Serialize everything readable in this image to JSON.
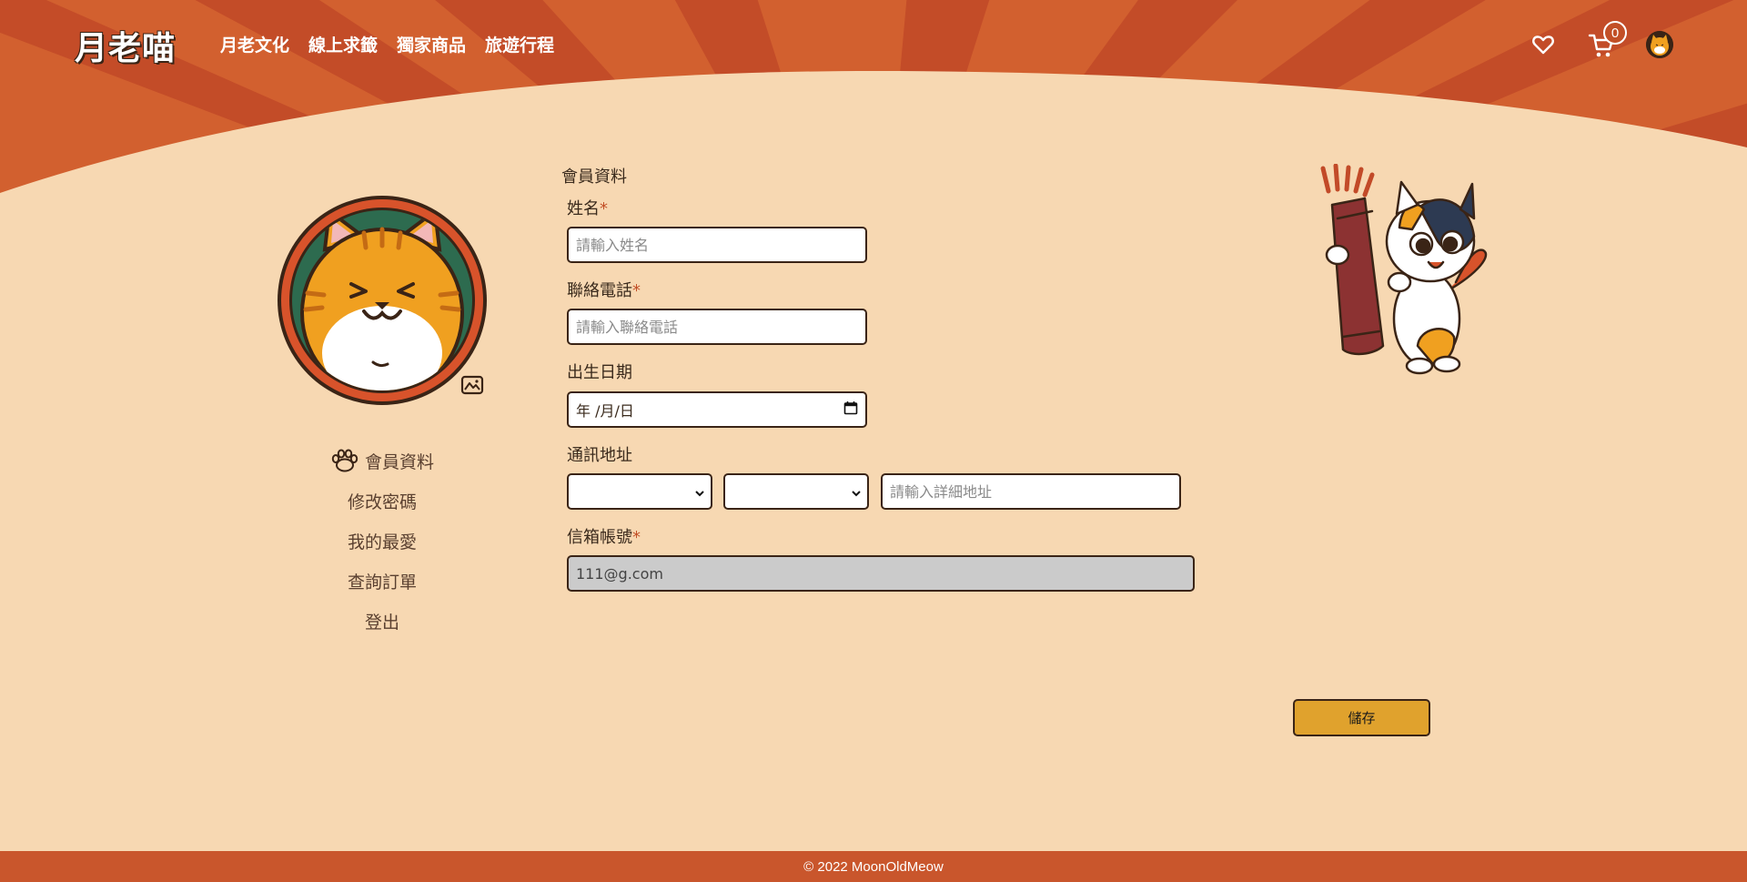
{
  "brand": {
    "logo_text": "月老喵"
  },
  "nav": {
    "items": [
      "月老文化",
      "線上求籤",
      "獨家商品",
      "旅遊行程"
    ]
  },
  "header": {
    "cart_count": "0"
  },
  "icons": {
    "wishlist": "heart-icon",
    "cart": "cart-icon",
    "user": "user-avatar-icon",
    "upload": "image-upload-icon",
    "menu_active": "paw-icon"
  },
  "sidebar": {
    "items": [
      {
        "label": "會員資料",
        "active": true
      },
      {
        "label": "修改密碼"
      },
      {
        "label": "我的最愛"
      },
      {
        "label": "查詢訂單"
      },
      {
        "label": "登出"
      }
    ]
  },
  "form": {
    "title": "會員資料",
    "name": {
      "label": "姓名",
      "required": "*",
      "placeholder": "請輸入姓名",
      "value": ""
    },
    "phone": {
      "label": "聯絡電話",
      "required": "*",
      "placeholder": "請輸入聯絡電話",
      "value": ""
    },
    "birthday": {
      "label": "出生日期",
      "display": "年 /月/日"
    },
    "address": {
      "label": "通訊地址",
      "city": "",
      "district": "",
      "detail_placeholder": "請輸入詳細地址"
    },
    "email": {
      "label": "信箱帳號",
      "required": "*",
      "value": "111@g.com"
    },
    "save_label": "儲存"
  },
  "footer": {
    "text": "© 2022 MoonOldMeow"
  },
  "colors": {
    "page_bg": "#f7d8b2",
    "header_orange": "#c9562c",
    "accent_gold": "#e0a22d",
    "dark_brown": "#3a2416"
  }
}
